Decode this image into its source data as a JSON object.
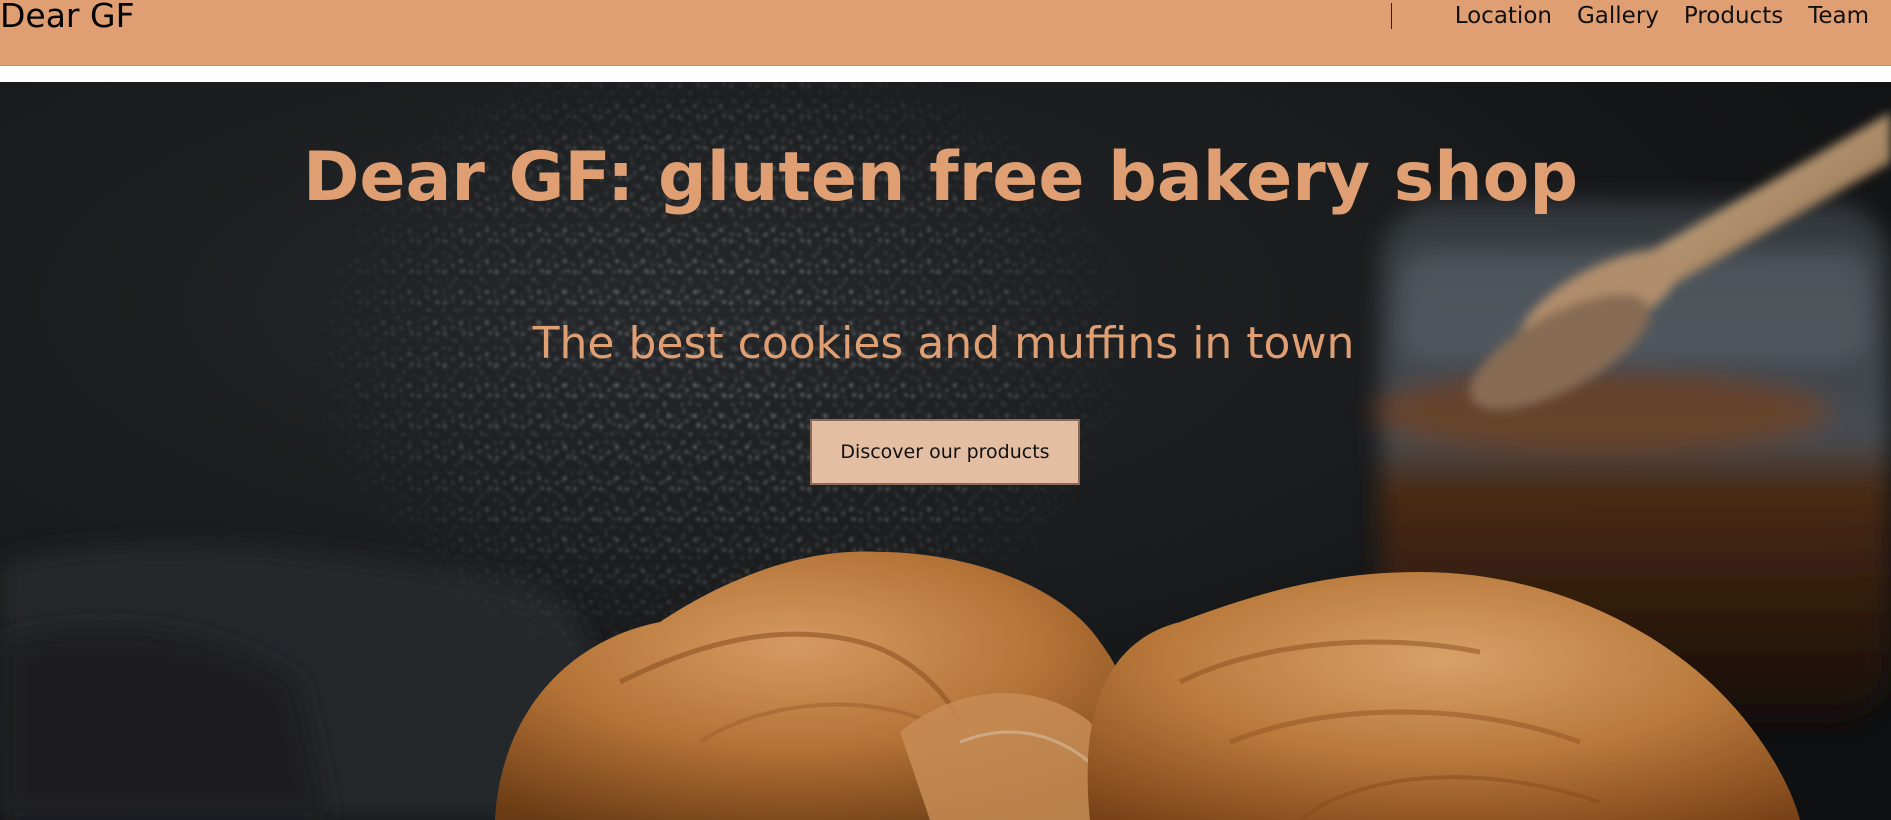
{
  "header": {
    "brand": "Dear GF",
    "nav": [
      "Location",
      "Gallery",
      "Products",
      "Team"
    ]
  },
  "hero": {
    "title": "Dear GF: gluten free bakery shop",
    "subtitle": "The best cookies and muffins in town",
    "cta_label": "Discover our products",
    "image": "croissants-with-powdered-sugar"
  },
  "colors": {
    "accent": "#df9f73",
    "button_bg": "#e3bea3",
    "hero_dark": "#1b1d1f"
  }
}
